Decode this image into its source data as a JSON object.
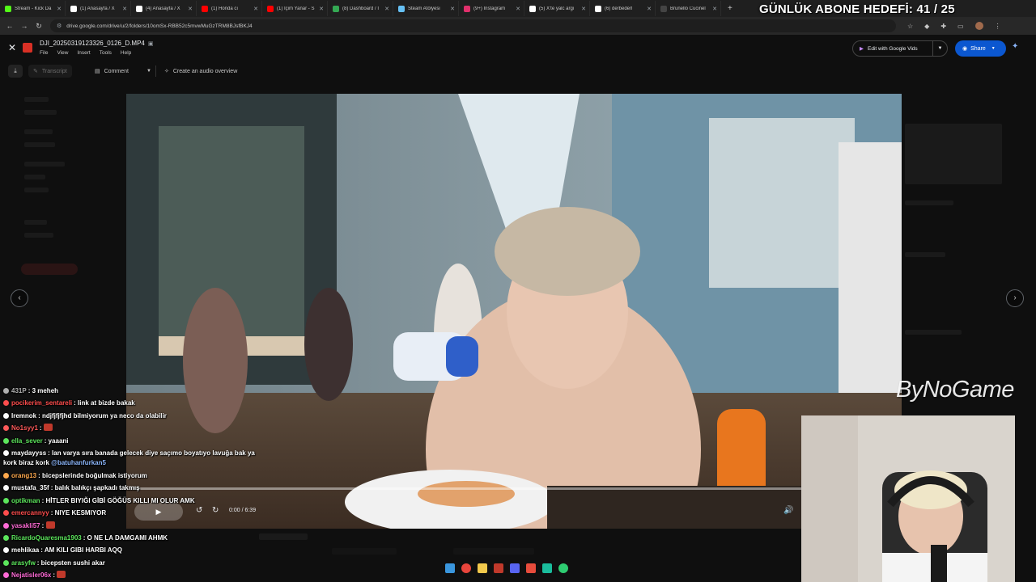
{
  "overlay": {
    "sub_goal": "GÜNLÜK ABONE HEDEFİ: 41 / 25"
  },
  "browser": {
    "tabs": [
      {
        "label": "Stream - Kick Da",
        "color": "#53fc18"
      },
      {
        "label": "(1) Anasayfa / X",
        "color": "#ffffff"
      },
      {
        "label": "(4) Anasayfa / X",
        "color": "#ffffff"
      },
      {
        "label": "(1) Honda cı",
        "color": "#ff0000"
      },
      {
        "label": "(1) İçim Yanar - S",
        "color": "#ff0000"
      },
      {
        "label": "(8) Dashboard / I",
        "color": "#34a853"
      },
      {
        "label": "Steam Atölyesi",
        "color": "#66c0f4"
      },
      {
        "label": "(9+) Instagram",
        "color": "#e1306c"
      },
      {
        "label": "(5) X'te yalc argı",
        "color": "#ffffff"
      },
      {
        "label": "(6) derbederl",
        "color": "#ffffff"
      },
      {
        "label": "Brunello Cucinel",
        "color": "#444444"
      }
    ],
    "url": "drive.google.com/drive/u/2/folders/10omSx-RBB52c5mvwMuGzTRM8BJsfBKJ4"
  },
  "viewer": {
    "file_name": "DJI_20250319123326_0126_D.MP4",
    "menu": [
      "File",
      "View",
      "Insert",
      "Tools",
      "Help"
    ],
    "edit_vids_label": "Edit with Google Vids",
    "share_label": "Share",
    "toolbar": {
      "transcript": "Transcript",
      "comment": "Comment",
      "audio_overview": "Create an audio overview"
    },
    "player": {
      "time": "0:00 / 6:39",
      "progress": 0
    },
    "watermark": "ByNoGame"
  },
  "chat": [
    {
      "user": "431P",
      "text": ": 3 meheh",
      "color": "#b0b0b0"
    },
    {
      "user": "pocikerim_sentareli",
      "text": ": link at bizde bakak",
      "color": "#ff4d4d"
    },
    {
      "user": "Iremnok",
      "text": ": ndjfjfjfjhd bilmiyorum ya neco da olabilir",
      "color": "#ffffff"
    },
    {
      "user": "No1syy1",
      "text": ":",
      "color": "#ff5a5a"
    },
    {
      "user": "ella_sever",
      "text": ": yaaani",
      "color": "#5ce65c"
    },
    {
      "user": "maydayyss",
      "text": ": lan varya sıra banada gelecek diye saçımo boyatıyo lavuğa bak ya kork biraz kork",
      "mention": "@batuhanfurkan5",
      "color": "#ffffff"
    },
    {
      "user": "orang13",
      "text": ": bicepslerinde boğulmak istiyorum",
      "color": "#ffa94d"
    },
    {
      "user": "mustafa_35f",
      "text": ": balık balıkçı şapkadı takmış",
      "color": "#ffffff"
    },
    {
      "user": "optikman",
      "text": ": HİTLER BIYIĞI GİBİ GÖĞÜS KILLI MI OLUR AMK",
      "color": "#5ce65c"
    },
    {
      "user": "emercannyy",
      "text": ": NIYE KESMIYOR",
      "color": "#ff4d4d"
    },
    {
      "user": "yasakli57",
      "text": ":",
      "color": "#ff6bd6"
    },
    {
      "user": "RicardoQuaresma1903",
      "text": ": O NE LA DAMGAMI AHMK",
      "color": "#5ce65c"
    },
    {
      "user": "mehlikaa",
      "text": ": AM KILI GIBI HARBI AQQ",
      "color": "#ffffff"
    },
    {
      "user": "arasyfw",
      "text": ": bicepsten sushi akar",
      "color": "#5ce65c"
    },
    {
      "user": "Nejatisler06x",
      "text": ":",
      "color": "#ff6bd6"
    }
  ]
}
